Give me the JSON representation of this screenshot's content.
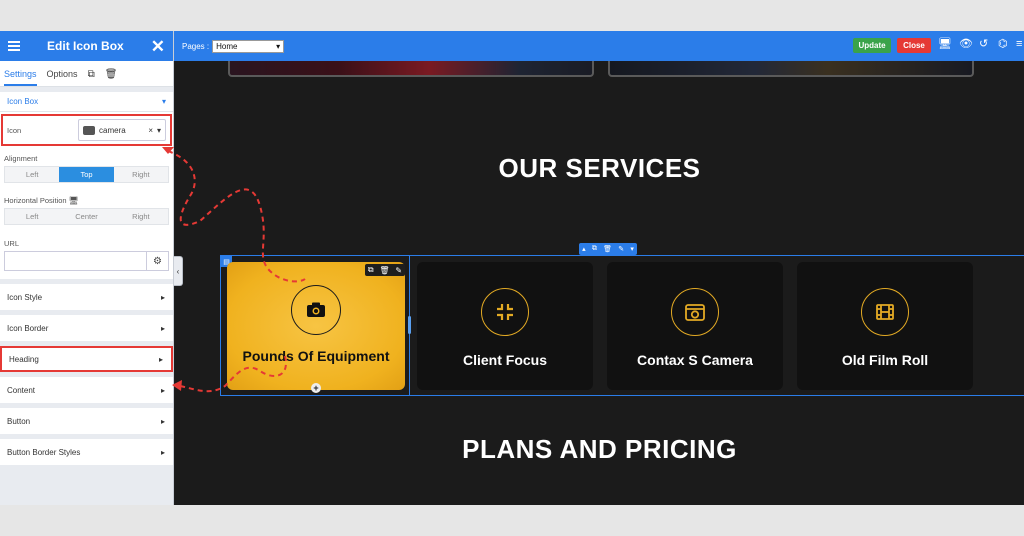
{
  "panel": {
    "title": "Edit Icon Box",
    "tabs": {
      "settings": "Settings",
      "options": "Options"
    },
    "section_icon_box": "Icon Box",
    "icon_label": "Icon",
    "icon_value": "camera",
    "icon_clear": "×",
    "alignment_label": "Alignment",
    "alignment_options": [
      "Left",
      "Top",
      "Right"
    ],
    "horizontal_label": "Horizontal Position",
    "horizontal_options": [
      "Left",
      "Center",
      "Right"
    ],
    "url_label": "URL",
    "sections": [
      "Icon Style",
      "Icon Border",
      "Heading",
      "Content",
      "Button",
      "Button Border Styles"
    ]
  },
  "topbar": {
    "pages_label": "Pages :",
    "page_value": "Home",
    "update_label": "Update",
    "close_label": "Close"
  },
  "canvas": {
    "services_heading": "OUR SERVICES",
    "pricing_heading": "PLANS AND PRICING",
    "cards": [
      {
        "label": "Pounds Of Equipment",
        "icon": "camera-icon"
      },
      {
        "label": "Client Focus",
        "icon": "compress-icon"
      },
      {
        "label": "Contax S Camera",
        "icon": "camera-box-icon"
      },
      {
        "label": "Old Film Roll",
        "icon": "film-icon"
      }
    ]
  },
  "colors": {
    "accent": "#2b7de9",
    "update": "#3aa34a",
    "close": "#e53935",
    "card_active": "#f0b21f",
    "icon_ring": "#e3aa24"
  }
}
